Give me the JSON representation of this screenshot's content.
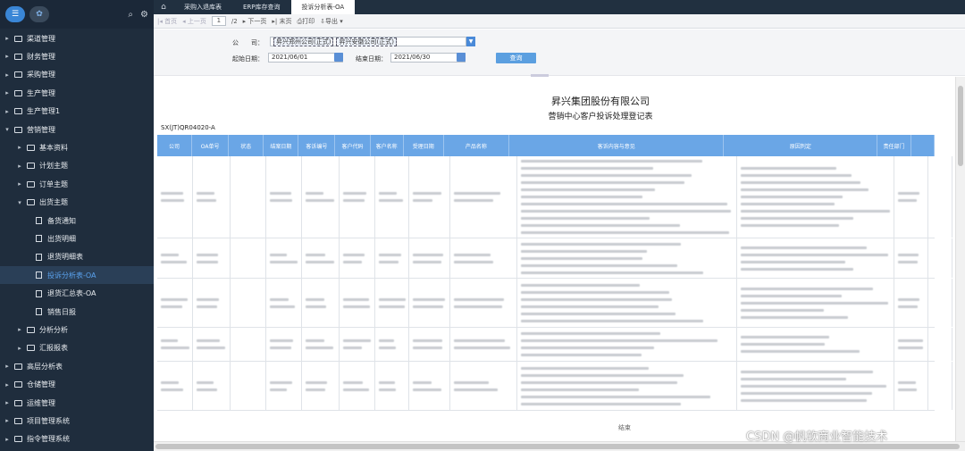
{
  "sidebar": {
    "items": [
      {
        "label": "渠道管理",
        "level": 0,
        "expanded": false
      },
      {
        "label": "财务管理",
        "level": 0,
        "expanded": false
      },
      {
        "label": "采购管理",
        "level": 0,
        "expanded": false
      },
      {
        "label": "生产管理",
        "level": 0,
        "expanded": false
      },
      {
        "label": "生产管理1",
        "level": 0,
        "expanded": false
      },
      {
        "label": "营销管理",
        "level": 0,
        "expanded": true
      },
      {
        "label": "基本资料",
        "level": 1,
        "expanded": false
      },
      {
        "label": "计划主题",
        "level": 1,
        "expanded": false
      },
      {
        "label": "订单主题",
        "level": 1,
        "expanded": false
      },
      {
        "label": "出货主题",
        "level": 1,
        "expanded": true
      },
      {
        "label": "备货通知",
        "level": 2
      },
      {
        "label": "出货明细",
        "level": 2
      },
      {
        "label": "退货明细表",
        "level": 2
      },
      {
        "label": "投诉分析表-OA",
        "level": 2,
        "active": true
      },
      {
        "label": "退货汇总表-OA",
        "level": 2
      },
      {
        "label": "销售日报",
        "level": 2
      },
      {
        "label": "分析分析",
        "level": 1,
        "expanded": false
      },
      {
        "label": "汇报报表",
        "level": 1,
        "expanded": false
      },
      {
        "label": "高层分析表",
        "level": 0,
        "expanded": false
      },
      {
        "label": "仓储管理",
        "level": 0,
        "expanded": false
      },
      {
        "label": "运维管理",
        "level": 0,
        "expanded": false
      },
      {
        "label": "项目管理系统",
        "level": 0,
        "expanded": false
      },
      {
        "label": "指令管理系统",
        "level": 0,
        "expanded": false
      }
    ]
  },
  "tabs": [
    {
      "label": "采购入退库表",
      "active": false
    },
    {
      "label": "ERP库存查询",
      "active": false
    },
    {
      "label": "投诉分析表-OA",
      "active": true
    }
  ],
  "toolbar": {
    "first": "首页",
    "prev": "上一页",
    "page": "1",
    "total": "/2",
    "next": "下一页",
    "last": "末页",
    "print": "打印",
    "export": "导出"
  },
  "filter": {
    "company_label": "公　　司：",
    "company_values": [
      "昇兴郑州公司(正式)",
      "昇兴安徽公司(正式)"
    ],
    "start_label": "起始日期：",
    "start_value": "2021/06/01",
    "end_label": "结束日期：",
    "end_value": "2021/06/30",
    "query": "查询"
  },
  "report": {
    "company": "昇兴集团股份有限公司",
    "subtitle": "营销中心客户投诉处理登记表",
    "code": "SX(JT)QR04020-A",
    "columns": [
      "公司",
      "OA单号",
      "状态",
      "结案日期",
      "客诉编号",
      "客户代码",
      "客户名称",
      "受理日期",
      "产品名称",
      "客诉内容与意见",
      "原因判定",
      "责任部门"
    ],
    "end_text": "结束"
  },
  "watermark": "CSDN @帆软商业智能技术",
  "colors": {
    "sidebar_bg": "#1f2d3d",
    "accent": "#3a86d6",
    "table_header": "#6aa6e6",
    "active_text": "#5aa2ee"
  }
}
